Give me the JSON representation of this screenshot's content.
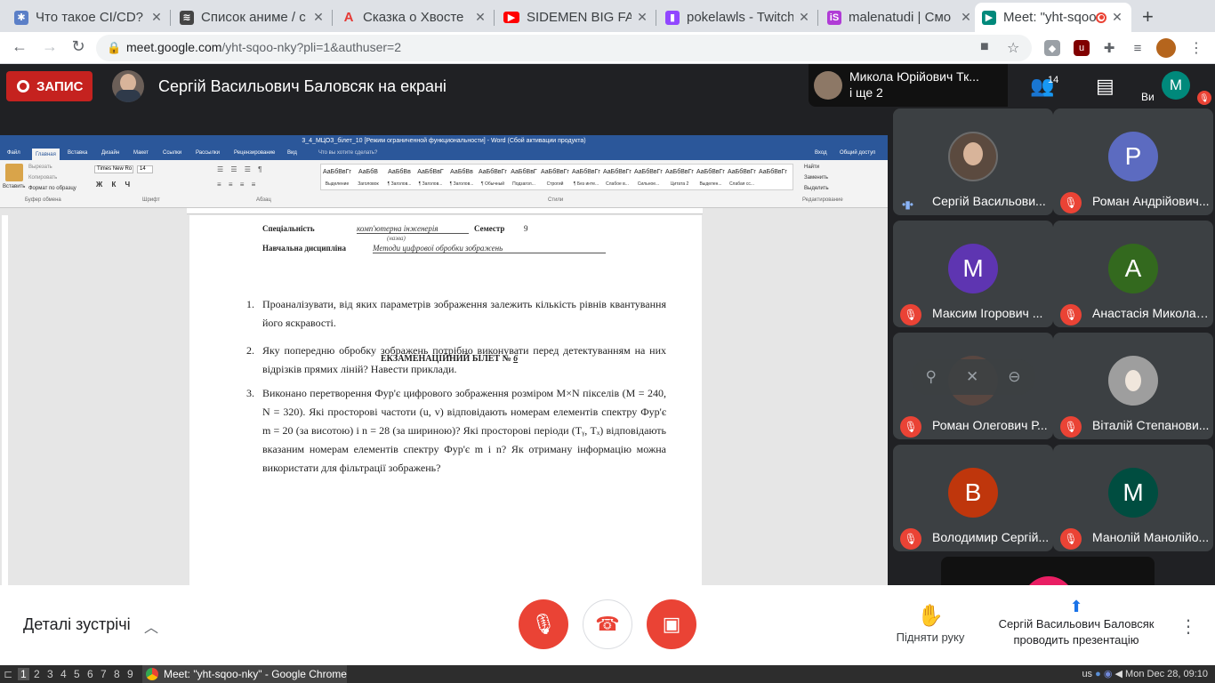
{
  "browser": {
    "tabs": [
      {
        "title": "Что такое CI/CD?",
        "favicon": "gear-icon",
        "color": "#5b7fc7"
      },
      {
        "title": "Список аниме / с",
        "favicon": "anime-icon",
        "color": "#444444"
      },
      {
        "title": "Сказка о Хвосте",
        "favicon": "a-logo-icon",
        "color": "#e53935"
      },
      {
        "title": "SIDEMEN BIG FAT",
        "favicon": "youtube-icon",
        "color": "#ff0000"
      },
      {
        "title": "pokelawls - Twitch",
        "favicon": "twitch-icon",
        "color": "#9146ff"
      },
      {
        "title": "malenatudi | Смо",
        "favicon": "live-icon",
        "color": "#b03bd6"
      },
      {
        "title": "Meet: \"yht-sqoo-nky\"",
        "favicon": "meet-icon",
        "color": "#00897b",
        "active": true
      }
    ],
    "url_host": "meet.google.com",
    "url_path": "/yht-sqoo-nky?pli=1&authuser=2"
  },
  "meet": {
    "record_label": "ЗАПИС",
    "presenter_title": "Сергій Васильович Баловсяк на екрані",
    "active_speaker": {
      "name": "Микола Юрійович Тк...",
      "others": "і ще 2"
    },
    "people_count": "14",
    "self_label": "Ви",
    "self_initial": "M",
    "participants": [
      {
        "name": "Сергій Васильови...",
        "initial": "",
        "color": "#5b4a3f",
        "speaking": true
      },
      {
        "name": "Роман Андрійович...",
        "initial": "P",
        "color": "#5c6bc0"
      },
      {
        "name": "Максим Ігорович ...",
        "initial": "M",
        "color": "#5e35b1"
      },
      {
        "name": "Анастасія Миколаї...",
        "initial": "A",
        "color": "#33691e"
      },
      {
        "name": "Роман Олегович Р...",
        "initial": "",
        "color": "#6d4c41"
      },
      {
        "name": "Віталій Степанови...",
        "initial": "",
        "color": "#9e9e9e"
      },
      {
        "name": "Володимир Сергій...",
        "initial": "B",
        "color": "#bf360c"
      },
      {
        "name": "Манолій Манолійо...",
        "initial": "M",
        "color": "#004d40"
      }
    ],
    "details_label": "Деталі зустрічі",
    "raise_hand_label": "Підняти руку",
    "presenting_line1": "Сергій Васильович Баловсяк",
    "presenting_line2": "проводить презентацію"
  },
  "word": {
    "title": "3_4_МЦОЗ_білет_10 [Режим ограниченной функциональности] - Word (Сбой активации продукта)",
    "tabs": [
      "Файл",
      "Главная",
      "Вставка",
      "Дизайн",
      "Макет",
      "Ссылки",
      "Рассылки",
      "Рецензирование",
      "Вид",
      "Что вы хотите сделать?"
    ],
    "share": "Общий доступ",
    "login": "Вход",
    "font_name": "Times New Ro",
    "font_size": "14",
    "clipboard": [
      "Вырезать",
      "Копировать",
      "Формат по образцу"
    ],
    "paste": "Вставить",
    "groups": [
      "Буфер обмена",
      "Шрифт",
      "Абзац",
      "Стили",
      "Редактирование"
    ],
    "styles": [
      {
        "sample": "АаБбВвГг",
        "name": "Выделение"
      },
      {
        "sample": "АаБбВ",
        "name": "Заголовок"
      },
      {
        "sample": "АаБбВв",
        "name": "¶ Заголов..."
      },
      {
        "sample": "АаБбВвГ",
        "name": "¶ Заголов..."
      },
      {
        "sample": "АаБбВв",
        "name": "¶ Заголов..."
      },
      {
        "sample": "АаБбВвГг",
        "name": "¶ Обычный"
      },
      {
        "sample": "АаБбВвГ",
        "name": "Подзагол..."
      },
      {
        "sample": "АаБбВвГг",
        "name": "Строгий"
      },
      {
        "sample": "АаБбВвГг",
        "name": "¶ Без инте..."
      },
      {
        "sample": "АаБбВвГг",
        "name": "Слабое в..."
      },
      {
        "sample": "АаБбВвГг",
        "name": "Сильное..."
      },
      {
        "sample": "АаБбВвГг",
        "name": "Цитата 2"
      },
      {
        "sample": "АаБбВвГг",
        "name": "Выделен..."
      },
      {
        "sample": "АаБбВвГг",
        "name": "Слабая сс..."
      },
      {
        "sample": "АаБбВвГг",
        "name": ""
      }
    ],
    "editing": [
      "Найти",
      "Заменить",
      "Выделить"
    ]
  },
  "document": {
    "spec_label": "Спеціальність",
    "spec_value": "комп'ютерна інженерія",
    "spec_note": "(назва)",
    "semester_label": "Семестр",
    "semester_value": "9",
    "discipline_label": "Навчальна дисципліна",
    "discipline_value": "Методи цифрової обробки зображень",
    "ticket_title": "ЕКЗАМЕНАЦІЙНИЙ БІЛЕТ №",
    "ticket_number": "6",
    "questions": [
      {
        "n": "1.",
        "text": "Проаналізувати, від яких параметрів зображення залежить кількість рівнів квантування його яскравості."
      },
      {
        "n": "2.",
        "text": "Яку попередню обробку зображень потрібно виконувати перед детектуванням на них відрізків прямих ліній? Навести приклади."
      },
      {
        "n": "3.",
        "text": "Виконано перетворення Фур'є цифрового зображення розміром M×N пікселів (M = 240, N = 320). Які просторові частоти (u, v) відповідають номерам елементів спектру Фур'є m = 20 (за висотою) і n = 28 (за шириною)? Які просторові періоди (Tᵧ, Tₓ) відповідають вказаним номерам елементів спектру Фур'є m і n? Як отриману інформацію можна використати для фільтрації зображень?"
      }
    ]
  },
  "taskbar": {
    "workspaces": [
      "1",
      "2",
      "3",
      "4",
      "5",
      "6",
      "7",
      "8",
      "9"
    ],
    "window_title": "Meet: \"yht-sqoo-nky\" - Google Chrome",
    "layout": "us",
    "clock": "Mon Dec 28, 09:10"
  }
}
